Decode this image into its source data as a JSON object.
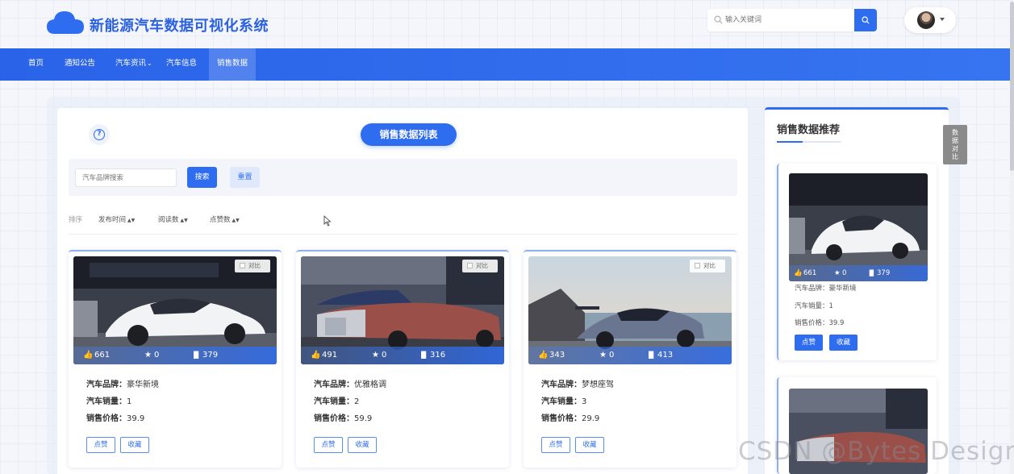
{
  "header": {
    "site_title": "新能源汽车数据可视化系统",
    "logo_icon": "cloud-icon",
    "search_placeholder": "输入关键词",
    "search_icon": "search-icon"
  },
  "nav": {
    "items": [
      "首页",
      "通知公告",
      "汽车资讯",
      "汽车信息",
      "销售数据"
    ],
    "dropdown_marker": "⌄",
    "active": "销售数据"
  },
  "list": {
    "help_glyph": "?",
    "title": "销售数据列表",
    "search_placeholder": "汽车品牌搜索",
    "search_button": "搜索",
    "reset_button": "重置",
    "sort_label": "排序",
    "sort_options": [
      "发布时间",
      "阅读数",
      "点赞数"
    ],
    "sort_arrows": "▲▼"
  },
  "cards": [
    {
      "compare": "对比",
      "likes": "661",
      "favorites": "0",
      "views": "379",
      "brand_label": "汽车品牌：",
      "brand": "豪华新境",
      "sales_label": "汽车销量：",
      "sales": "1",
      "price_label": "销售价格：",
      "price": "39.9",
      "like_button": "点赞",
      "fav_button": "收藏"
    },
    {
      "compare": "对比",
      "likes": "491",
      "favorites": "0",
      "views": "316",
      "brand_label": "汽车品牌：",
      "brand": "优雅格调",
      "sales_label": "汽车销量：",
      "sales": "2",
      "price_label": "销售价格：",
      "price": "59.9",
      "like_button": "点赞",
      "fav_button": "收藏"
    },
    {
      "compare": "对比",
      "likes": "343",
      "favorites": "0",
      "views": "413",
      "brand_label": "汽车品牌：",
      "brand": "梦想座驾",
      "sales_label": "汽车销量：",
      "sales": "3",
      "price_label": "销售价格：",
      "price": "29.9",
      "like_button": "点赞",
      "fav_button": "收藏"
    }
  ],
  "sidebar": {
    "title": "销售数据推荐",
    "compare_tab": "数据对比",
    "items": [
      {
        "likes": "661",
        "favorites": "0",
        "views": "379",
        "brand_line": "汽车品牌：豪华新境",
        "sales_line": "汽车销量：1",
        "price_line": "销售价格：39.9",
        "like_button": "点赞",
        "fav_button": "收藏"
      }
    ]
  },
  "icons": {
    "like": "👍",
    "favorite": "★",
    "views": "▐▌"
  },
  "watermark": "CSDN @Bytes Design",
  "colors": {
    "primary": "#2f6df0",
    "nav": "#2a63e8"
  }
}
